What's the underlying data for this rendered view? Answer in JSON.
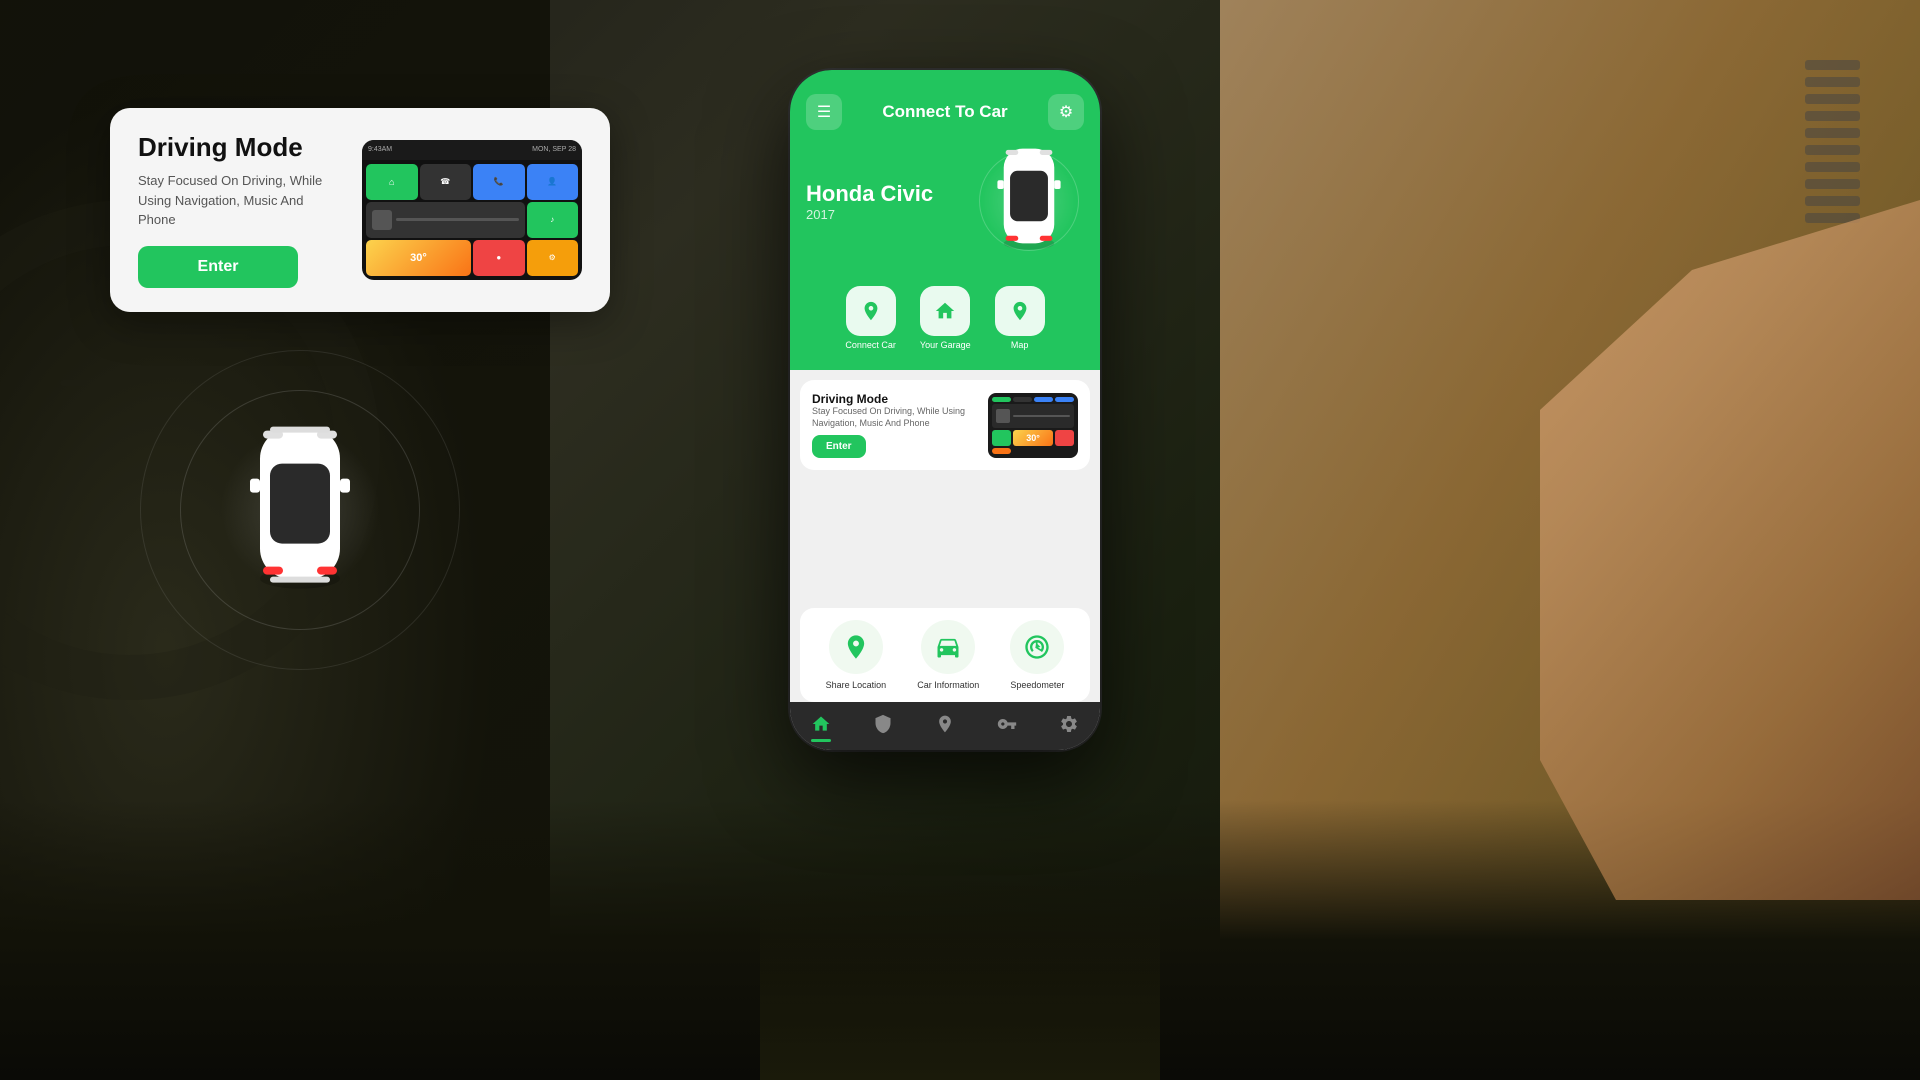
{
  "background": {
    "color": "#1a1a10"
  },
  "driving_mode_card": {
    "title": "Driving Mode",
    "description": "Stay Focused On Driving, While Using Navigation, Music And Phone",
    "enter_button": "Enter"
  },
  "phone_app": {
    "header": {
      "title": "Connect To Car",
      "menu_icon": "☰",
      "settings_icon": "⚙"
    },
    "car": {
      "name": "Honda Civic",
      "year": "2017"
    },
    "quick_actions": [
      {
        "label": "Connect Car",
        "icon": "🔗"
      },
      {
        "label": "Your Garage",
        "icon": "🏠"
      },
      {
        "label": "Map",
        "icon": "📍"
      }
    ],
    "driving_mode_mini": {
      "title": "Driving Mode",
      "description": "Stay Focused On Driving, While Using Navigation, Music And Phone",
      "enter_button": "Enter"
    },
    "features": [
      {
        "label": "Share Location",
        "icon": "📍"
      },
      {
        "label": "Car Information",
        "icon": "🚗"
      },
      {
        "label": "Speedometer",
        "icon": "🎛"
      }
    ],
    "bottom_nav": [
      {
        "label": "home",
        "icon": "⌂",
        "active": true
      },
      {
        "label": "shield",
        "icon": "🛡",
        "active": false
      },
      {
        "label": "location",
        "icon": "📍",
        "active": false
      },
      {
        "label": "key",
        "icon": "🔑",
        "active": false
      },
      {
        "label": "settings",
        "icon": "⚙",
        "active": false
      }
    ]
  },
  "colors": {
    "primary_green": "#22c55e",
    "dark_bg": "#2a2a2a",
    "card_bg": "#f5f5f5",
    "white": "#ffffff"
  }
}
